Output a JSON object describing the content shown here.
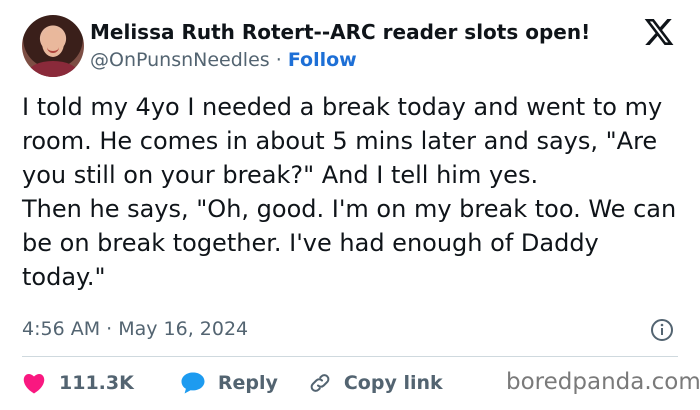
{
  "author": {
    "name": "Melissa Ruth Rotert--ARC reader slots open!",
    "handle": "@OnPunsnNeedles",
    "separator": "·",
    "follow_label": "Follow",
    "avatar_icon": "profile-photo"
  },
  "logo_icon": "x-logo",
  "tweet": {
    "paragraph_1": "I told my 4yo I needed a break today and went to my room. He comes in about 5 mins later and says, \"Are you still on your break?\" And I tell him yes.",
    "paragraph_2": "Then he says, \"Oh, good. I'm on my break too. We can be on break together. I've had enough of Daddy today.\""
  },
  "timestamp": "4:56 AM · May 16, 2024",
  "actions": {
    "like_count": "111.3K",
    "reply_label": "Reply",
    "copy_link_label": "Copy link"
  },
  "watermark": "boredpanda.com",
  "colors": {
    "accent": "#1d9bf0",
    "heart": "#f91880",
    "muted": "#536471"
  }
}
